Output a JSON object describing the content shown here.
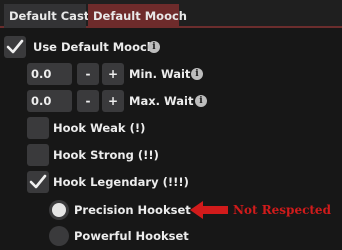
{
  "tabs": [
    {
      "label": "Default Cast",
      "active": false
    },
    {
      "label": "Default Mooch",
      "active": true
    }
  ],
  "options": {
    "use_default_mooch": {
      "label": "Use Default Mooch",
      "checked": true
    },
    "min_wait": {
      "value": "0.0",
      "minus": "-",
      "plus": "+",
      "label": "Min. Wait"
    },
    "max_wait": {
      "value": "0.0",
      "minus": "-",
      "plus": "+",
      "label": "Max. Wait"
    },
    "hook_weak": {
      "label": "Hook Weak (!)",
      "checked": false
    },
    "hook_strong": {
      "label": "Hook Strong (!!)",
      "checked": false
    },
    "hook_legendary": {
      "label": "Hook Legendary (!!!)",
      "checked": true
    },
    "precision_hookset": {
      "label": "Precision Hookset",
      "selected": true
    },
    "powerful_hookset": {
      "label": "Powerful Hookset",
      "selected": false
    }
  },
  "annotation": {
    "text": "Not Respected",
    "color": "#d11b1b"
  },
  "info_glyph": "i",
  "colors": {
    "accent": "#6e2b2b",
    "control_bg": "#3a3a3c",
    "background": "#171717"
  }
}
